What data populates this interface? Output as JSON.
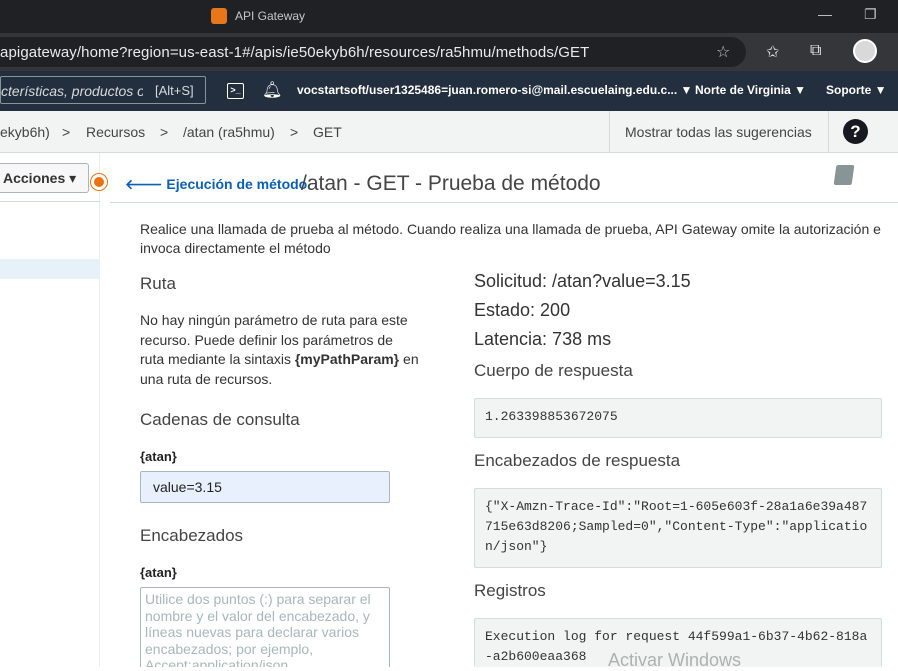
{
  "browser": {
    "title": "API Gateway",
    "url": "apigateway/home?region=us-east-1#/apis/ie50ekyb6h/resources/ra5hmu/methods/GET",
    "minimize": "—",
    "restore": "❐"
  },
  "aws_nav": {
    "search_placeholder": "cterísticas, productos o",
    "search_shortcut": "[Alt+S]",
    "cloudshell": ">_",
    "user": "vocstartsoft/user1325486=juan.romero-si@mail.escuelaing.edu.c... ▼",
    "region": "Norte de Virginia ▼",
    "support": "Soporte ▼"
  },
  "breadcrumb": {
    "api": "ekyb6h)",
    "sep1": ">",
    "resources": "Recursos",
    "sep2": ">",
    "resource": "/atan (ra5hmu)",
    "sep3": ">",
    "method": "GET",
    "suggestions": "Mostrar todas las sugerencias",
    "help": "?"
  },
  "sidebar": {
    "actions_label": "Acciones ▾"
  },
  "header": {
    "back_label": "🡐 Ejecución de método",
    "title": "/atan - GET - Prueba de método"
  },
  "intro": "Realice una llamada de prueba al método. Cuando realiza una llamada de prueba, API Gateway omite la autorización e invoca directamente el método",
  "path_section": {
    "heading": "Ruta",
    "text_before": "No hay ningún parámetro de ruta para este recurso. Puede definir los parámetros de ruta mediante la sintaxis ",
    "param_syntax": "{myPathParam}",
    "text_after": " en una ruta de recursos."
  },
  "query_section": {
    "heading": "Cadenas de consulta",
    "label": "{atan}",
    "value": "value=3.15"
  },
  "headers_section": {
    "heading": "Encabezados",
    "label": "{atan}",
    "placeholder": "Utilice dos puntos (:) para separar el nombre y el valor del encabezado, y líneas nuevas para declarar varios encabezados; por ejemplo, Accept:application/json."
  },
  "result": {
    "request": "Solicitud: /atan?value=3.15",
    "status": "Estado: 200",
    "latency": "Latencia: 738 ms",
    "body_heading": "Cuerpo de respuesta",
    "body": "1.263398853672075",
    "headers_heading": "Encabezados de respuesta",
    "headers": "{\"X-Amzn-Trace-Id\":\"Root=1-605e603f-28a1a6e39a487715e63d8206;Sampled=0\",\"Content-Type\":\"application/json\"}",
    "logs_heading": "Registros",
    "logs": "Execution log for request 44f599a1-6b37-4b62-818a-a2b600eaa368"
  },
  "watermark": "Activar Windows"
}
